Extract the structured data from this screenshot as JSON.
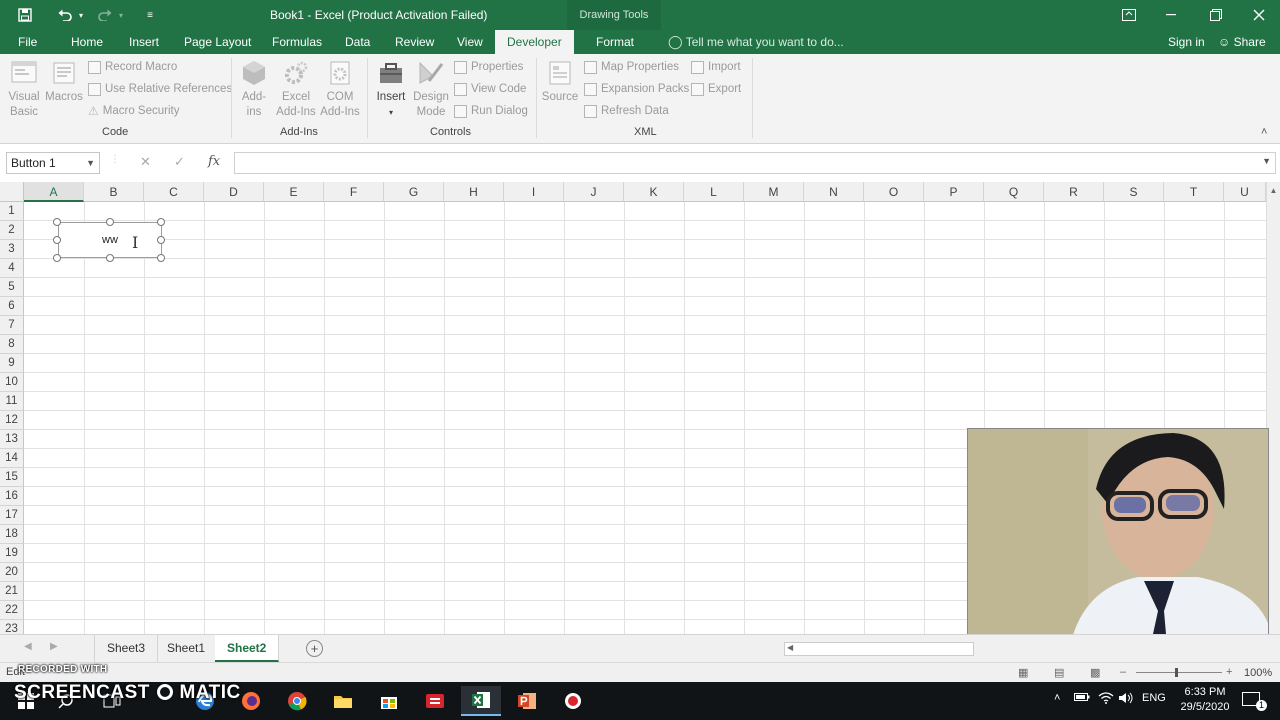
{
  "window": {
    "title": "Book1 - Excel (Product Activation Failed)",
    "context_tab": "Drawing Tools"
  },
  "ribbon_tabs": [
    {
      "label": "File"
    },
    {
      "label": "Home"
    },
    {
      "label": "Insert"
    },
    {
      "label": "Page Layout"
    },
    {
      "label": "Formulas"
    },
    {
      "label": "Data"
    },
    {
      "label": "Review"
    },
    {
      "label": "View"
    },
    {
      "label": "Developer",
      "active": true
    },
    {
      "label": "Format"
    }
  ],
  "tell_me": "Tell me what you want to do...",
  "account": {
    "sign_in": "Sign in",
    "share": "Share"
  },
  "ribbon": {
    "code": {
      "label": "Code",
      "visual_basic": "Visual Basic",
      "macros": "Macros",
      "record_macro": "Record Macro",
      "use_relative_references": "Use Relative References",
      "macro_security": "Macro Security"
    },
    "addins": {
      "label": "Add-Ins",
      "addins": "Add-ins",
      "excel_addins": "Excel Add-Ins",
      "com_addins": "COM Add-Ins"
    },
    "controls": {
      "label": "Controls",
      "insert": "Insert",
      "design_mode": "Design Mode",
      "properties": "Properties",
      "view_code": "View Code",
      "run_dialog": "Run Dialog"
    },
    "xml": {
      "label": "XML",
      "source": "Source",
      "map_properties": "Map Properties",
      "expansion_packs": "Expansion Packs",
      "refresh_data": "Refresh Data",
      "import": "Import",
      "export": "Export"
    }
  },
  "formula_bar": {
    "name_box": "Button 1",
    "cancel": "✕",
    "enter": "✓",
    "fx": "fx",
    "value": ""
  },
  "grid": {
    "columns": [
      "A",
      "B",
      "C",
      "D",
      "E",
      "F",
      "G",
      "H",
      "I",
      "J",
      "K",
      "L",
      "M",
      "N",
      "O",
      "P",
      "Q",
      "R",
      "S",
      "T",
      "U"
    ],
    "rows": [
      "1",
      "2",
      "3",
      "4",
      "5",
      "6",
      "7",
      "8",
      "9",
      "10",
      "11",
      "12",
      "13",
      "14",
      "15",
      "16",
      "17",
      "18",
      "19",
      "20",
      "21",
      "22",
      "23"
    ],
    "selected_column": "A",
    "form_button_text": "ww"
  },
  "sheets": [
    {
      "name": "Sheet3"
    },
    {
      "name": "Sheet1"
    },
    {
      "name": "Sheet2",
      "active": true
    }
  ],
  "status_bar": {
    "text": "Edit",
    "zoom": "100%"
  },
  "watermark": {
    "line1": "RECORDED WITH",
    "line2_a": "SCREENCAST",
    "line2_b": "MATIC"
  },
  "taskbar": {
    "lang": "ENG",
    "time": "6:33 PM",
    "date": "29/5/2020",
    "notification_count": "1",
    "apps": [
      "file-explorer",
      "store",
      "ime",
      "excel",
      "powerpoint",
      "record"
    ]
  }
}
